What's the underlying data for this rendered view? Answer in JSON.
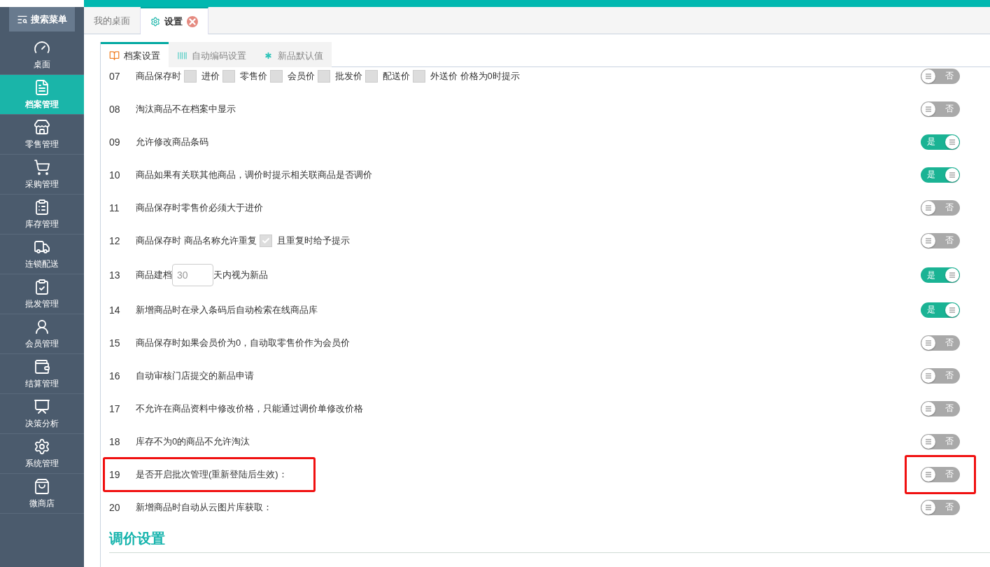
{
  "sidebar": {
    "search_button": "搜索菜单",
    "items": [
      {
        "label": "桌面",
        "selected": false
      },
      {
        "label": "档案管理",
        "selected": true
      },
      {
        "label": "零售管理",
        "selected": false
      },
      {
        "label": "采购管理",
        "selected": false
      },
      {
        "label": "库存管理",
        "selected": false
      },
      {
        "label": "连锁配送",
        "selected": false
      },
      {
        "label": "批发管理",
        "selected": false
      },
      {
        "label": "会员管理",
        "selected": false
      },
      {
        "label": "结算管理",
        "selected": false
      },
      {
        "label": "决策分析",
        "selected": false
      },
      {
        "label": "系统管理",
        "selected": false
      },
      {
        "label": "微商店",
        "selected": false
      }
    ]
  },
  "tabs": [
    {
      "label": "我的桌面",
      "selected": false,
      "closable": false
    },
    {
      "label": "设置",
      "selected": true,
      "closable": true
    }
  ],
  "sub_tabs": [
    {
      "label": "档案设置",
      "selected": true
    },
    {
      "label": "自动编码设置",
      "selected": false
    },
    {
      "label": "新品默认值",
      "selected": false
    }
  ],
  "rows": [
    {
      "number": "07",
      "highlighted": false,
      "toggle": {
        "on": false,
        "text": "否"
      },
      "parts": [
        {
          "kind": "text",
          "text": "商品保存时"
        },
        {
          "kind": "checkbox",
          "checked": false
        },
        {
          "kind": "text",
          "text": "进价"
        },
        {
          "kind": "checkbox",
          "checked": false
        },
        {
          "kind": "text",
          "text": "零售价"
        },
        {
          "kind": "checkbox",
          "checked": false
        },
        {
          "kind": "text",
          "text": "会员价"
        },
        {
          "kind": "checkbox",
          "checked": false
        },
        {
          "kind": "text",
          "text": "批发价"
        },
        {
          "kind": "checkbox",
          "checked": false
        },
        {
          "kind": "text",
          "text": "配送价"
        },
        {
          "kind": "checkbox",
          "checked": false
        },
        {
          "kind": "text",
          "text": "外送价 价格为0时提示"
        }
      ]
    },
    {
      "number": "08",
      "highlighted": false,
      "toggle": {
        "on": false,
        "text": "否"
      },
      "parts": [
        {
          "kind": "text",
          "text": "淘汰商品不在档案中显示"
        }
      ]
    },
    {
      "number": "09",
      "highlighted": false,
      "toggle": {
        "on": true,
        "text": "是"
      },
      "parts": [
        {
          "kind": "text",
          "text": "允许修改商品条码"
        }
      ]
    },
    {
      "number": "10",
      "highlighted": false,
      "toggle": {
        "on": true,
        "text": "是"
      },
      "parts": [
        {
          "kind": "text",
          "text": "商品如果有关联其他商品，调价时提示相关联商品是否调价"
        }
      ]
    },
    {
      "number": "11",
      "highlighted": false,
      "toggle": {
        "on": false,
        "text": "否"
      },
      "parts": [
        {
          "kind": "text",
          "text": "商品保存时零售价必须大于进价"
        }
      ]
    },
    {
      "number": "12",
      "highlighted": false,
      "toggle": {
        "on": false,
        "text": "否"
      },
      "parts": [
        {
          "kind": "text",
          "text": "商品保存时 商品名称允许重复"
        },
        {
          "kind": "checkbox",
          "checked": true
        },
        {
          "kind": "text",
          "text": "且重复时给予提示"
        }
      ]
    },
    {
      "number": "13",
      "highlighted": false,
      "toggle": {
        "on": true,
        "text": "是"
      },
      "parts": [
        {
          "kind": "text",
          "text": "商品建档"
        },
        {
          "kind": "input",
          "value": "30"
        },
        {
          "kind": "text",
          "text": "天内视为新品"
        }
      ]
    },
    {
      "number": "14",
      "highlighted": false,
      "toggle": {
        "on": true,
        "text": "是"
      },
      "parts": [
        {
          "kind": "text",
          "text": "新增商品时在录入条码后自动检索在线商品库"
        }
      ]
    },
    {
      "number": "15",
      "highlighted": false,
      "toggle": {
        "on": false,
        "text": "否"
      },
      "parts": [
        {
          "kind": "text",
          "text": "商品保存时如果会员价为0，自动取零售价作为会员价"
        }
      ]
    },
    {
      "number": "16",
      "highlighted": false,
      "toggle": {
        "on": false,
        "text": "否"
      },
      "parts": [
        {
          "kind": "text",
          "text": "自动审核门店提交的新品申请"
        }
      ]
    },
    {
      "number": "17",
      "highlighted": false,
      "toggle": {
        "on": false,
        "text": "否"
      },
      "parts": [
        {
          "kind": "text",
          "text": "不允许在商品资料中修改价格，只能通过调价单修改价格"
        }
      ]
    },
    {
      "number": "18",
      "highlighted": false,
      "toggle": {
        "on": false,
        "text": "否"
      },
      "parts": [
        {
          "kind": "text",
          "text": "库存不为0的商品不允许淘汰"
        }
      ]
    },
    {
      "number": "19",
      "highlighted": true,
      "toggle": {
        "on": false,
        "text": "否"
      },
      "parts": [
        {
          "kind": "text",
          "text": "是否开启批次管理(重新登陆后生效)："
        }
      ]
    },
    {
      "number": "20",
      "highlighted": false,
      "toggle": {
        "on": false,
        "text": "否"
      },
      "parts": [
        {
          "kind": "text",
          "text": "新增商品时自动从云图片库获取："
        }
      ]
    }
  ],
  "section_title": "调价设置"
}
